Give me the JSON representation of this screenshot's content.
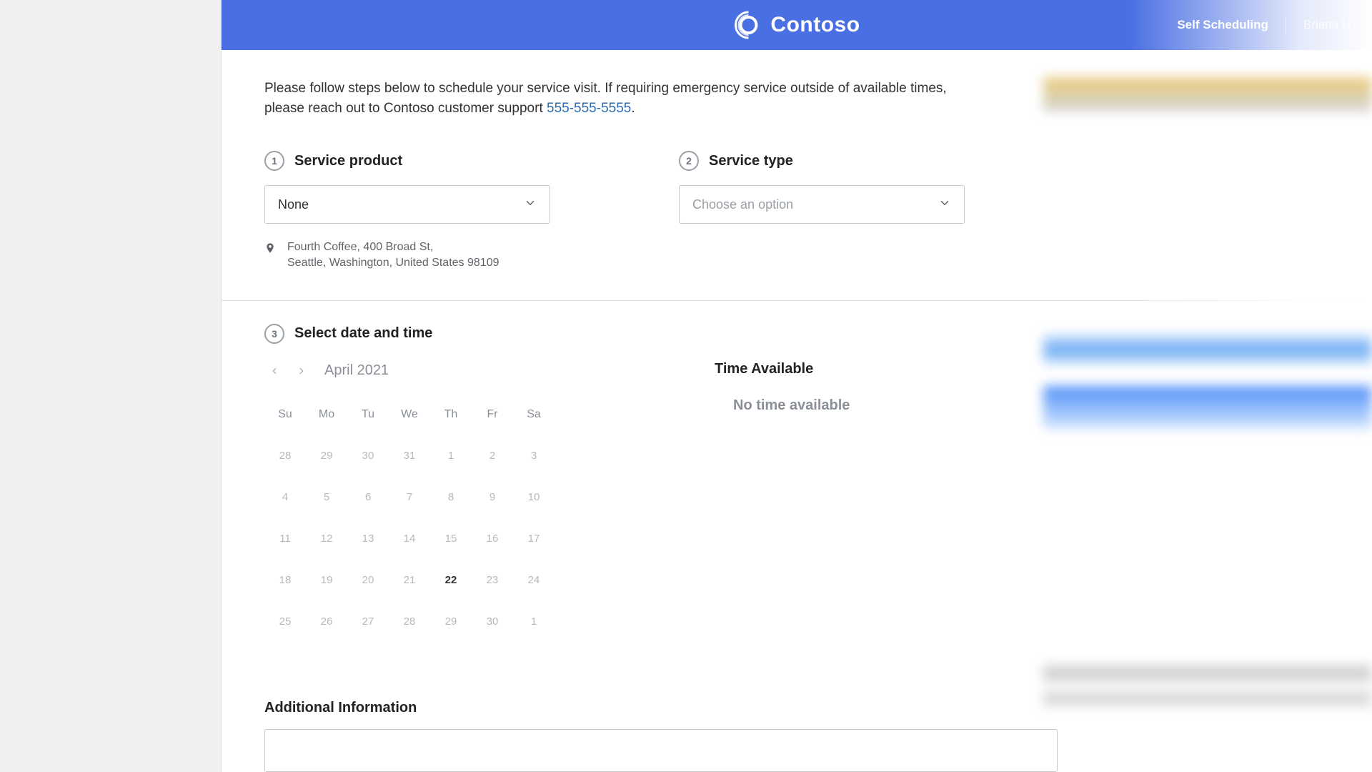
{
  "header": {
    "brand": "Contoso",
    "self_scheduling": "Self Scheduling",
    "user_name": "Briana H"
  },
  "intro": {
    "text_before_phone": "Please follow steps below to schedule your service visit. If requiring emergency service outside of available times, please reach out to Contoso customer support ",
    "phone": "555-555-5555",
    "text_after_phone": "."
  },
  "steps": {
    "product": {
      "num": "1",
      "title": "Service product",
      "value": "None"
    },
    "type": {
      "num": "2",
      "title": "Service type",
      "placeholder": "Choose an option"
    },
    "datetime": {
      "num": "3",
      "title": "Select date and time"
    }
  },
  "location": {
    "line1": "Fourth Coffee, 400 Broad St,",
    "line2": "Seattle, Washington, United States 98109"
  },
  "calendar": {
    "month_label": "April 2021",
    "dow": [
      "Su",
      "Mo",
      "Tu",
      "We",
      "Th",
      "Fr",
      "Sa"
    ],
    "days": [
      "28",
      "29",
      "30",
      "31",
      "1",
      "2",
      "3",
      "4",
      "5",
      "6",
      "7",
      "8",
      "9",
      "10",
      "11",
      "12",
      "13",
      "14",
      "15",
      "16",
      "17",
      "18",
      "19",
      "20",
      "21",
      "22",
      "23",
      "24",
      "25",
      "26",
      "27",
      "28",
      "29",
      "30",
      "1"
    ],
    "selected_index": 25
  },
  "time": {
    "heading": "Time Available",
    "empty": "No time available"
  },
  "additional": {
    "title": "Additional Information"
  }
}
